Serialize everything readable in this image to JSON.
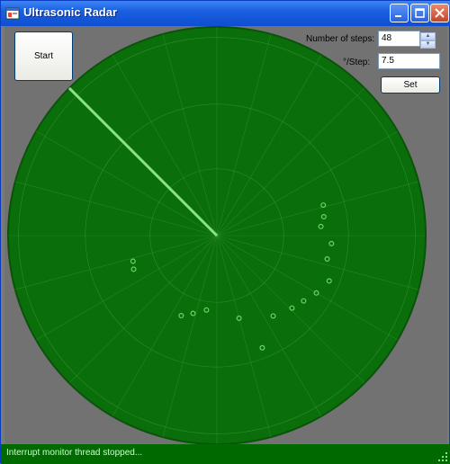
{
  "window": {
    "title": "Ultrasonic Radar"
  },
  "controls": {
    "start_label": "Start",
    "steps_label": "Number of steps:",
    "steps_value": "48",
    "deg_label": "°/Step:",
    "deg_value": "7.5",
    "set_label": "Set"
  },
  "status": {
    "text": "Interrupt monitor thread stopped..."
  },
  "colors": {
    "radar_fill": "#0a6e0a",
    "grid": "#3a9a3a",
    "sweep": "#8be08b",
    "echo": "#6ad66a",
    "statusbar": "#006a00"
  },
  "radar": {
    "steps": 48,
    "deg_per_step": 7.5,
    "sweep_angle_deg": 135,
    "echoes": [
      {
        "angle": 197,
        "distance": 0.42
      },
      {
        "angle": 202,
        "distance": 0.43
      },
      {
        "angle": 246,
        "distance": 0.42
      },
      {
        "angle": 253,
        "distance": 0.39
      },
      {
        "angle": 262,
        "distance": 0.36
      },
      {
        "angle": 285,
        "distance": 0.41
      },
      {
        "angle": 305,
        "distance": 0.47
      },
      {
        "angle": 292,
        "distance": 0.58
      },
      {
        "angle": 316,
        "distance": 0.5
      },
      {
        "angle": 323,
        "distance": 0.52
      },
      {
        "angle": 330,
        "distance": 0.55
      },
      {
        "angle": 338,
        "distance": 0.58
      },
      {
        "angle": 348,
        "distance": 0.54
      },
      {
        "angle": 356,
        "distance": 0.55
      },
      {
        "angle": 5,
        "distance": 0.5
      },
      {
        "angle": 10,
        "distance": 0.52
      },
      {
        "angle": 16,
        "distance": 0.53
      }
    ]
  }
}
